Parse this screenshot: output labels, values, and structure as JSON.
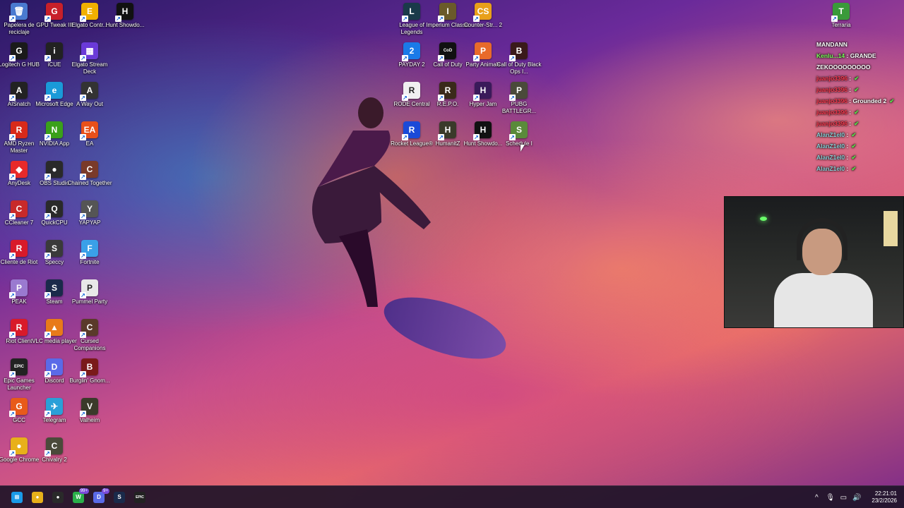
{
  "desktop_icons": [
    {
      "label": "Papelera de reciclaje",
      "glyph": "🗑",
      "color": "#4a7ad0"
    },
    {
      "label": "GPU Tweak III",
      "glyph": "G",
      "color": "#c8202a"
    },
    {
      "label": "Elgato Contr...",
      "glyph": "E",
      "color": "#f0b000"
    },
    {
      "label": "Hunt Showdo...",
      "glyph": "H",
      "color": "#111111"
    },
    {
      "label": "Logitech G HUB",
      "glyph": "G",
      "color": "#1a1a1a"
    },
    {
      "label": "iCUE",
      "glyph": "i",
      "color": "#222222"
    },
    {
      "label": "Elgato Stream Deck",
      "glyph": "▦",
      "color": "#6a3ad8"
    },
    {
      "label": "AISnatch",
      "glyph": "A",
      "color": "#222222"
    },
    {
      "label": "Microsoft Edge",
      "glyph": "e",
      "color": "#1a9ad8"
    },
    {
      "label": "A Way Out",
      "glyph": "A",
      "color": "#333333"
    },
    {
      "label": "AMD Ryzen Master",
      "glyph": "R",
      "color": "#d82a1a"
    },
    {
      "label": "NVIDIA App",
      "glyph": "N",
      "color": "#3aa01a"
    },
    {
      "label": "EA",
      "glyph": "EA",
      "color": "#e8501a"
    },
    {
      "label": "AnyDesk",
      "glyph": "◆",
      "color": "#e82a2a"
    },
    {
      "label": "OBS Studio",
      "glyph": "●",
      "color": "#2a2a2a"
    },
    {
      "label": "Chained Together",
      "glyph": "C",
      "color": "#7a3a2a"
    },
    {
      "label": "CCleaner 7",
      "glyph": "C",
      "color": "#c82a2a"
    },
    {
      "label": "QuickCPU",
      "glyph": "Q",
      "color": "#2a2a2a"
    },
    {
      "label": "YAPYAP",
      "glyph": "Y",
      "color": "#555555"
    },
    {
      "label": "Cliente de Riot",
      "glyph": "R",
      "color": "#d81a2a"
    },
    {
      "label": "Speccy",
      "glyph": "S",
      "color": "#3a3a3a"
    },
    {
      "label": "Fortnite",
      "glyph": "F",
      "color": "#3aa0e8"
    },
    {
      "label": "PEAK",
      "glyph": "P",
      "color": "#9a7ad0"
    },
    {
      "label": "Steam",
      "glyph": "S",
      "color": "#1a2a4a"
    },
    {
      "label": "Pummel Party",
      "glyph": "P",
      "color": "#e8e8e8"
    },
    {
      "label": "Riot Client",
      "glyph": "R",
      "color": "#d81a2a"
    },
    {
      "label": "VLC media player",
      "glyph": "▲",
      "color": "#e87a1a"
    },
    {
      "label": "Cursed Companions",
      "glyph": "C",
      "color": "#5a3a2a"
    },
    {
      "label": "Epic Games Launcher",
      "glyph": "EPIC",
      "color": "#222222"
    },
    {
      "label": "Discord",
      "glyph": "D",
      "color": "#5a6ae8"
    },
    {
      "label": "Burglin' Gnom...",
      "glyph": "B",
      "color": "#7a1a1a"
    },
    {
      "label": "GCC",
      "glyph": "G",
      "color": "#e85a1a"
    },
    {
      "label": "Telegram",
      "glyph": "✈",
      "color": "#2aa0d8"
    },
    {
      "label": "Valheim",
      "glyph": "V",
      "color": "#3a3a2a"
    },
    {
      "label": "Google Chrome",
      "glyph": "●",
      "color": "#e8b01a"
    },
    {
      "label": "Chivalry 2",
      "glyph": "C",
      "color": "#4a4a3a"
    },
    {
      "label": "League of Legends",
      "glyph": "L",
      "color": "#1a3a4a"
    },
    {
      "label": "Imperium Classic",
      "glyph": "I",
      "color": "#6a5a2a"
    },
    {
      "label": "Counter-Str... 2",
      "glyph": "CS",
      "color": "#e8a01a"
    },
    {
      "label": "PAYDAY 2",
      "glyph": "2",
      "color": "#1a7ae8"
    },
    {
      "label": "Call of Duty",
      "glyph": "CoD",
      "color": "#111111"
    },
    {
      "label": "Party Animals",
      "glyph": "P",
      "color": "#e86a2a"
    },
    {
      "label": "Call of Duty Black Ops I...",
      "glyph": "B",
      "color": "#3a1a1a"
    },
    {
      "label": "RODE Central",
      "glyph": "R",
      "color": "#f0f0f0"
    },
    {
      "label": "R.E.P.O.",
      "glyph": "R",
      "color": "#3a2a1a"
    },
    {
      "label": "Hyper Jam",
      "glyph": "H",
      "color": "#3a1a5a"
    },
    {
      "label": "PUBG BATTLEGR...",
      "glyph": "P",
      "color": "#4a4a3a"
    },
    {
      "label": "Rocket League®",
      "glyph": "R",
      "color": "#1a4ad8"
    },
    {
      "label": "HumanitZ",
      "glyph": "H",
      "color": "#3a3a2a"
    },
    {
      "label": "Hunt Showdo...",
      "glyph": "H",
      "color": "#111111"
    },
    {
      "label": "Schedule I",
      "glyph": "S",
      "color": "#5a8a3a"
    },
    {
      "label": "Terraria",
      "glyph": "T",
      "color": "#3a9a3a"
    }
  ],
  "chat": {
    "messages": [
      {
        "user": "MANDANN",
        "text": "",
        "style": "white"
      },
      {
        "user": "Kenlu...14",
        "text": ": GRANDE",
        "style": "green"
      },
      {
        "user": "ZEKOOOOOOOOO",
        "text": "",
        "style": "white"
      },
      {
        "user": "juanjo3396",
        "text": ":",
        "style": "red"
      },
      {
        "user": "juanjo3396",
        "text": ":",
        "style": "red"
      },
      {
        "user": "juanjo3396",
        "text": ": Grounded 2",
        "style": "red"
      },
      {
        "user": "juanjo3396",
        "text": ":",
        "style": "red"
      },
      {
        "user": "juanjo3396",
        "text": ":",
        "style": "red"
      },
      {
        "user": "AlanZ1el0",
        "text": ":",
        "style": "teal"
      },
      {
        "user": "AlanZ1el0",
        "text": ":",
        "style": "teal"
      },
      {
        "user": "AlanZ1el0",
        "text": ":",
        "style": "teal"
      },
      {
        "user": "AlanZ1el0",
        "text": ":",
        "style": "teal"
      }
    ],
    "check_glyph": "✔"
  },
  "taskbar": {
    "apps": [
      {
        "name": "start",
        "glyph": "⊞",
        "color": "#1a9ae8"
      },
      {
        "name": "chrome",
        "glyph": "●",
        "color": "#e8b01a"
      },
      {
        "name": "obs",
        "glyph": "●",
        "color": "#2a2a2a"
      },
      {
        "name": "whatsapp",
        "glyph": "W",
        "color": "#2ab04a",
        "badge": "99+"
      },
      {
        "name": "discord",
        "glyph": "D",
        "color": "#5a6ae8",
        "badge": "9+"
      },
      {
        "name": "steam",
        "glyph": "S",
        "color": "#1a2a4a"
      },
      {
        "name": "epic",
        "glyph": "EPIC",
        "color": "#222222"
      }
    ],
    "tray": {
      "chevron": "^",
      "mic": "🎙",
      "screen": "▭",
      "speaker": "🔊",
      "time": "22:21:01",
      "date": "23/2/2026"
    }
  }
}
